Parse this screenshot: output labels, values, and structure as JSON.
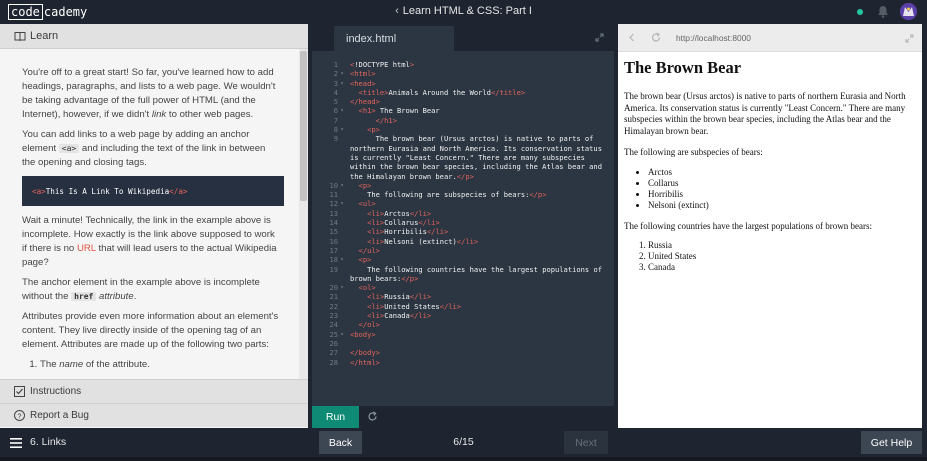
{
  "header": {
    "logo_boxed": "code",
    "logo_rest": "cademy",
    "course_title": "Learn HTML & CSS: Part I"
  },
  "learn": {
    "header_label": "Learn",
    "paragraphs": {
      "p1": "You're off to a great start! So far, you've learned how to add headings, paragraphs, and lists to a web page. We wouldn't be taking advantage of the full power of HTML (and the Internet), however, if we didn't ",
      "p1_em": "link",
      "p1_end": " to other web pages.",
      "p2_a": "You can add links to a web page by adding an anchor element ",
      "p2_code": "<a>",
      "p2_b": " and including the text of the link in between the opening and closing tags.",
      "example_open": "<a>",
      "example_text": "This Is A Link To Wikipedia",
      "example_close": "</a>",
      "p3_a": "Wait a minute! Technically, the link in the example above is incomplete. How exactly is the link above supposed to work if there is no ",
      "p3_url": "URL",
      "p3_b": " that will lead users to the actual Wikipedia page?",
      "p4_a": "The anchor element in the example above is incomplete without the ",
      "p4_code": "href",
      "p4_em": "attribute",
      "p4_end": ".",
      "p5": "Attributes provide even more information about an element's content. They live directly inside of the opening tag of an element. Attributes are made up of the following two parts:",
      "li1_em": "name",
      "li1_a": "The ",
      "li1_b": " of the attribute."
    },
    "instructions_label": "Instructions",
    "report_label": "Report a Bug"
  },
  "editor": {
    "tab_label": "index.html",
    "run_label": "Run",
    "lines": [
      {
        "n": "1",
        "fold": "",
        "html": "<span class='tg'>&lt;</span>!DOCTYPE html<span class='tg'>&gt;</span>"
      },
      {
        "n": "2",
        "fold": "▾",
        "html": "<span class='tg'>&lt;html&gt;</span>"
      },
      {
        "n": "3",
        "fold": "▾",
        "html": "<span class='tg'>&lt;head&gt;</span>"
      },
      {
        "n": "4",
        "fold": "",
        "html": "  <span class='tg'>&lt;title&gt;</span>Animals Around the World<span class='tg'>&lt;/title&gt;</span>"
      },
      {
        "n": "5",
        "fold": "",
        "html": "<span class='tg'>&lt;/head&gt;</span>"
      },
      {
        "n": "6",
        "fold": "▾",
        "html": "  <span class='tg'>&lt;h1&gt;</span> The Brown Bear"
      },
      {
        "n": "7",
        "fold": "",
        "html": "      <span class='tg'>&lt;/h1&gt;</span>"
      },
      {
        "n": "8",
        "fold": "▾",
        "html": "    <span class='tg'>&lt;p&gt;</span>"
      },
      {
        "n": "9",
        "fold": "",
        "html": "      The brown bear (Ursus arctos) is native to parts of northern Eurasia and North America. Its conservation status is currently \"Least Concern.\" There are many subspecies within the brown bear species, including the Atlas bear and the Himalayan brown bear.<span class='tg'>&lt;/p&gt;</span>"
      },
      {
        "n": "10",
        "fold": "▾",
        "html": "  <span class='tg'>&lt;p&gt;</span>"
      },
      {
        "n": "11",
        "fold": "",
        "html": "    The following are subspecies of bears:<span class='tg'>&lt;/p&gt;</span>"
      },
      {
        "n": "12",
        "fold": "▾",
        "html": "  <span class='tg'>&lt;ul&gt;</span>"
      },
      {
        "n": "13",
        "fold": "",
        "html": "    <span class='tg'>&lt;li&gt;</span>Arctos<span class='tg'>&lt;/li&gt;</span>"
      },
      {
        "n": "14",
        "fold": "",
        "html": "    <span class='tg'>&lt;li&gt;</span>Collarus<span class='tg'>&lt;/li&gt;</span>"
      },
      {
        "n": "15",
        "fold": "",
        "html": "    <span class='tg'>&lt;li&gt;</span>Horribilis<span class='tg'>&lt;/li&gt;</span>"
      },
      {
        "n": "16",
        "fold": "",
        "html": "    <span class='tg'>&lt;li&gt;</span>Nelsoni (extinct)<span class='tg'>&lt;/li&gt;</span>"
      },
      {
        "n": "17",
        "fold": "",
        "html": "  <span class='tg'>&lt;/ul&gt;</span>"
      },
      {
        "n": "18",
        "fold": "▾",
        "html": "  <span class='tg'>&lt;p&gt;</span>"
      },
      {
        "n": "19",
        "fold": "",
        "html": "    The following countries have the largest populations of brown bears:<span class='tg'>&lt;/p&gt;</span>"
      },
      {
        "n": "20",
        "fold": "▾",
        "html": "  <span class='tg'>&lt;ol&gt;</span>"
      },
      {
        "n": "21",
        "fold": "",
        "html": "    <span class='tg'>&lt;li&gt;</span>Russia<span class='tg'>&lt;/li&gt;</span>"
      },
      {
        "n": "22",
        "fold": "",
        "html": "    <span class='tg'>&lt;li&gt;</span>United States<span class='tg'>&lt;/li&gt;</span>"
      },
      {
        "n": "23",
        "fold": "",
        "html": "    <span class='tg'>&lt;li&gt;</span>Canada<span class='tg'>&lt;/li&gt;</span>"
      },
      {
        "n": "24",
        "fold": "",
        "html": "  <span class='tg'>&lt;/ol&gt;</span>"
      },
      {
        "n": "25",
        "fold": "▾",
        "html": "<span class='tg'>&lt;body&gt;</span>"
      },
      {
        "n": "26",
        "fold": "",
        "html": ""
      },
      {
        "n": "27",
        "fold": "",
        "html": "<span class='tg'>&lt;/body&gt;</span>"
      },
      {
        "n": "28",
        "fold": "",
        "html": "<span class='tg'>&lt;/html&gt;</span>"
      }
    ]
  },
  "browser": {
    "url": "http://localhost:8000",
    "heading": "The Brown Bear",
    "intro": "The brown bear (Ursus arctos) is native to parts of northern Eurasia and North America. Its conservation status is currently \"Least Concern.\" There are many subspecies within the brown bear species, including the Atlas bear and the Himalayan brown bear.",
    "subspecies_intro": "The following are subspecies of bears:",
    "subspecies": [
      "Arctos",
      "Collarus",
      "Horribilis",
      "Nelsoni (extinct)"
    ],
    "countries_intro": "The following countries have the largest populations of brown bears:",
    "countries": [
      "Russia",
      "United States",
      "Canada"
    ]
  },
  "footer": {
    "lesson": "6. Links",
    "back_label": "Back",
    "progress": "6/15",
    "next_label": "Next",
    "help_label": "Get Help"
  },
  "colors": {
    "dark": "#1e2530",
    "editor_bg": "#2c3642",
    "accent_green": "#0f8a74",
    "tag_red": "#e4645a"
  }
}
